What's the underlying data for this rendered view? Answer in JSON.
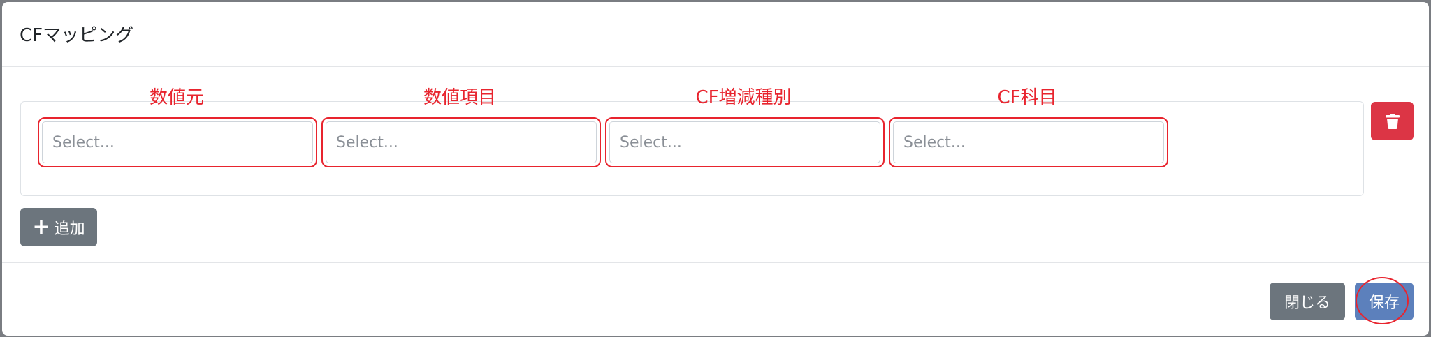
{
  "modal": {
    "title": "CFマッピング"
  },
  "fields": [
    {
      "label": "数値元",
      "placeholder": "Select..."
    },
    {
      "label": "数値項目",
      "placeholder": "Select..."
    },
    {
      "label": "CF増減種別",
      "placeholder": "Select..."
    },
    {
      "label": "CF科目",
      "placeholder": "Select..."
    }
  ],
  "buttons": {
    "delete_icon": "trash-icon",
    "add_icon": "plus-icon",
    "add_label": "追加",
    "close_label": "閉じる",
    "save_label": "保存"
  },
  "colors": {
    "annotation": "#e8242e",
    "danger": "#dc3545",
    "secondary": "#6c757d",
    "primary": "#5c80bc"
  }
}
